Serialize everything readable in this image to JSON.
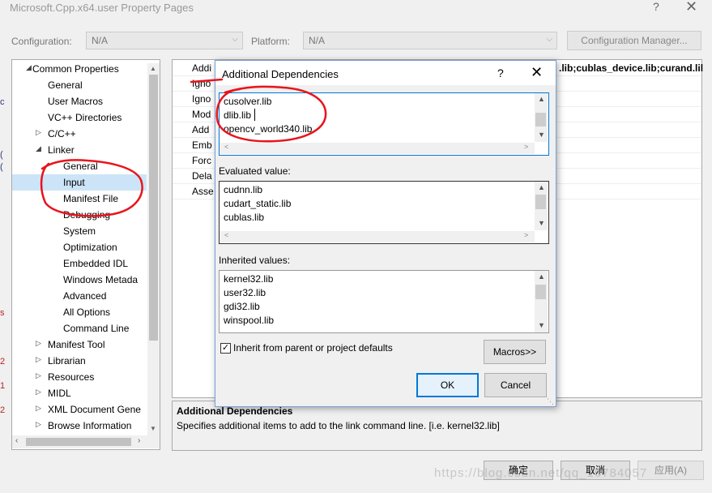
{
  "window": {
    "title": "Microsoft.Cpp.x64.user Property Pages",
    "help_glyph": "?",
    "close_glyph": "✕"
  },
  "toolbar": {
    "configuration_label": "Configuration:",
    "configuration_value": "N/A",
    "platform_label": "Platform:",
    "platform_value": "N/A",
    "config_manager_label": "Configuration Manager..."
  },
  "tree": {
    "items": [
      {
        "label": "Common Properties",
        "twisty": "◢"
      },
      {
        "label": "General",
        "twisty": ""
      },
      {
        "label": "User Macros",
        "twisty": ""
      },
      {
        "label": "VC++ Directories",
        "twisty": ""
      },
      {
        "label": "C/C++",
        "twisty": "▷"
      },
      {
        "label": "Linker",
        "twisty": "◢"
      },
      {
        "label": "General",
        "twisty": ""
      },
      {
        "label": "Input",
        "twisty": ""
      },
      {
        "label": "Manifest File",
        "twisty": ""
      },
      {
        "label": "Debugging",
        "twisty": ""
      },
      {
        "label": "System",
        "twisty": ""
      },
      {
        "label": "Optimization",
        "twisty": ""
      },
      {
        "label": "Embedded IDL",
        "twisty": ""
      },
      {
        "label": "Windows Metada",
        "twisty": ""
      },
      {
        "label": "Advanced",
        "twisty": ""
      },
      {
        "label": "All Options",
        "twisty": ""
      },
      {
        "label": "Command Line",
        "twisty": ""
      },
      {
        "label": "Manifest Tool",
        "twisty": "▷"
      },
      {
        "label": "Librarian",
        "twisty": "▷"
      },
      {
        "label": "Resources",
        "twisty": "▷"
      },
      {
        "label": "MIDL",
        "twisty": "▷"
      },
      {
        "label": "XML Document Gene",
        "twisty": "▷"
      },
      {
        "label": "Browse Information",
        "twisty": "▷"
      }
    ],
    "selected_index": 7
  },
  "grid": {
    "rows": [
      "Addi",
      "Igno",
      "Igno",
      "Mod",
      "Add",
      "Emb",
      "Forc",
      "Dela",
      "Asse"
    ],
    "first_row_value": ".lib;cublas_device.lib;curand.lil"
  },
  "description": {
    "title": "Additional Dependencies",
    "text": "Specifies additional items to add to the link command line. [i.e. kernel32.lib]"
  },
  "dialog": {
    "title": "Additional Dependencies",
    "help_glyph": "?",
    "close_glyph": "✕",
    "edit_lines": [
      "cusolver.lib",
      "dlib.lib",
      "opencv_world340.lib"
    ],
    "evaluated_label": "Evaluated value:",
    "evaluated_lines": [
      "cudnn.lib",
      "cudart_static.lib",
      "cublas.lib"
    ],
    "inherited_label": "Inherited values:",
    "inherited_lines": [
      "kernel32.lib",
      "user32.lib",
      "gdi32.lib",
      "winspool.lib"
    ],
    "inherit_checkbox_label": "Inherit from parent or project defaults",
    "inherit_checked": "✓",
    "macros_label": "Macros>>",
    "ok_label": "OK",
    "cancel_label": "Cancel"
  },
  "footer": {
    "ok_label": "确定",
    "cancel_label": "取消",
    "apply_label": "应用(A)"
  },
  "watermark": "https://blog.csdn.net/qq_16784057",
  "colors": {
    "selection": "#cce4f7",
    "annotation": "#e8141b",
    "ok_border": "#0078d7"
  }
}
